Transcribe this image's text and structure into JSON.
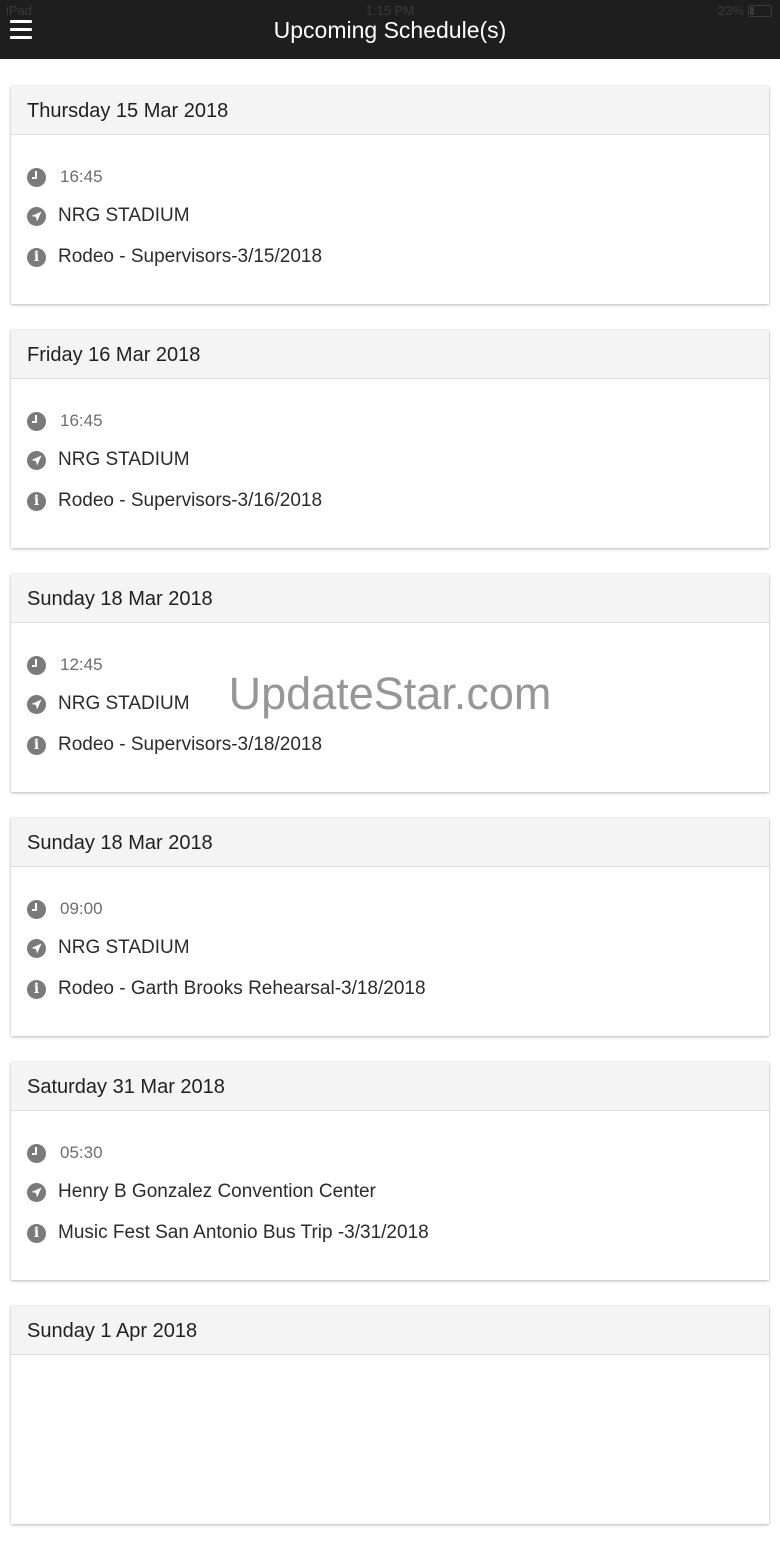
{
  "status_bar": {
    "device": "iPad",
    "time": "1:15 PM",
    "battery": "23%"
  },
  "header": {
    "title": "Upcoming Schedule(s)",
    "menu_icon": "hamburger-icon"
  },
  "schedules": [
    {
      "date": "Thursday 15 Mar 2018",
      "time": "16:45",
      "location": "NRG STADIUM",
      "event": "Rodeo - Supervisors-3/15/2018"
    },
    {
      "date": "Friday 16 Mar 2018",
      "time": "16:45",
      "location": "NRG STADIUM",
      "event": "Rodeo - Supervisors-3/16/2018"
    },
    {
      "date": "Sunday 18 Mar 2018",
      "time": "12:45",
      "location": "NRG STADIUM",
      "event": "Rodeo - Supervisors-3/18/2018"
    },
    {
      "date": "Sunday 18 Mar 2018",
      "time": "09:00",
      "location": "NRG STADIUM",
      "event": "Rodeo - Garth Brooks Rehearsal-3/18/2018"
    },
    {
      "date": "Saturday 31 Mar 2018",
      "time": "05:30",
      "location": "Henry B Gonzalez Convention Center",
      "event": "Music Fest San Antonio Bus Trip -3/31/2018"
    },
    {
      "date": "Sunday 1 Apr 2018"
    }
  ],
  "icons": {
    "time": "clock-icon",
    "location": "navigation-arrow-icon",
    "info": "info-icon"
  },
  "watermark": "UpdateStar.com",
  "colors": {
    "topbar": "#1e1e1e",
    "card_header": "#f4f4f4",
    "icon": "#7a7a7a"
  }
}
